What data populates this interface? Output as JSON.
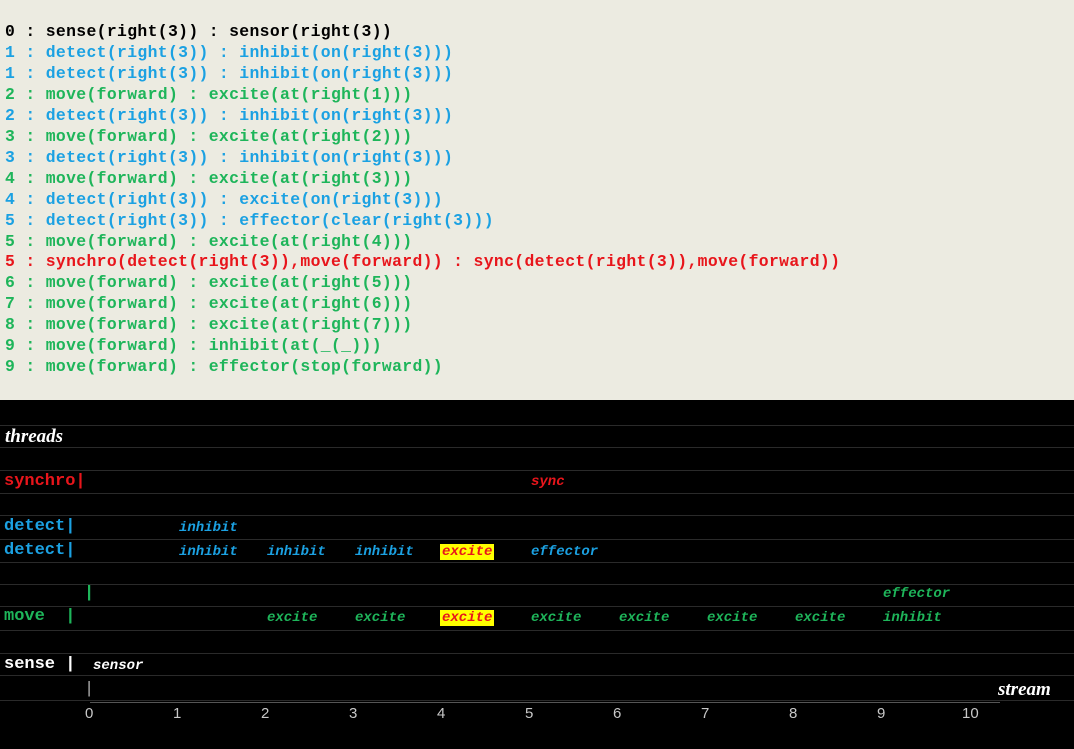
{
  "colors": {
    "black": "#000000",
    "blue": "#1ba1e2",
    "green": "#1eb55a",
    "red": "#e8151b",
    "white": "#ffffff",
    "highlight": "#ffff00"
  },
  "log": [
    {
      "text": "0 : sense(right(3)) : sensor(right(3))",
      "color": "black"
    },
    {
      "text": "1 : detect(right(3)) : inhibit(on(right(3)))",
      "color": "blue"
    },
    {
      "text": "1 : detect(right(3)) : inhibit(on(right(3)))",
      "color": "blue"
    },
    {
      "text": "2 : move(forward) : excite(at(right(1)))",
      "color": "green"
    },
    {
      "text": "2 : detect(right(3)) : inhibit(on(right(3)))",
      "color": "blue"
    },
    {
      "text": "3 : move(forward) : excite(at(right(2)))",
      "color": "green"
    },
    {
      "text": "3 : detect(right(3)) : inhibit(on(right(3)))",
      "color": "blue"
    },
    {
      "text": "4 : move(forward) : excite(at(right(3)))",
      "color": "green"
    },
    {
      "text": "4 : detect(right(3)) : excite(on(right(3)))",
      "color": "blue"
    },
    {
      "text": "5 : detect(right(3)) : effector(clear(right(3)))",
      "color": "blue"
    },
    {
      "text": "5 : move(forward) : excite(at(right(4)))",
      "color": "green"
    },
    {
      "text": "5 : synchro(detect(right(3)),move(forward)) : sync(detect(right(3)),move(forward))",
      "color": "red"
    },
    {
      "text": "6 : move(forward) : excite(at(right(5)))",
      "color": "green"
    },
    {
      "text": "7 : move(forward) : excite(at(right(6)))",
      "color": "green"
    },
    {
      "text": "8 : move(forward) : excite(at(right(7)))",
      "color": "green"
    },
    {
      "text": "9 : move(forward) : inhibit(at(_(_)))",
      "color": "green"
    },
    {
      "text": "9 : move(forward) : effector(stop(forward))",
      "color": "green"
    }
  ],
  "timeline": {
    "header": "threads",
    "stream_label": "stream",
    "axis_ticks": [
      "0",
      "1",
      "2",
      "3",
      "4",
      "5",
      "6",
      "7",
      "8",
      "9",
      "10"
    ],
    "rows": [
      {
        "name": "synchro-row",
        "label": "synchro|",
        "color": "red",
        "y": 0,
        "events": [
          {
            "t": 5,
            "text": "sync"
          }
        ]
      },
      {
        "name": "detect-row-1",
        "label": "detect|",
        "color": "blue",
        "y": 1,
        "events": [
          {
            "t": 1,
            "text": "inhibit"
          }
        ]
      },
      {
        "name": "detect-row-2",
        "label": "detect|",
        "color": "blue",
        "y": 2,
        "events": [
          {
            "t": 1,
            "text": "inhibit"
          },
          {
            "t": 2,
            "text": "inhibit"
          },
          {
            "t": 3,
            "text": "inhibit"
          },
          {
            "t": 4,
            "text": "excite",
            "highlight": true
          },
          {
            "t": 5,
            "text": "effector"
          }
        ]
      },
      {
        "name": "move-row-1",
        "label": "|",
        "color": "green",
        "y": 3,
        "events": [
          {
            "t": 9,
            "text": "effector"
          }
        ]
      },
      {
        "name": "move-row-2",
        "label": "move  |",
        "color": "green",
        "y": 4,
        "events": [
          {
            "t": 2,
            "text": "excite"
          },
          {
            "t": 3,
            "text": "excite"
          },
          {
            "t": 4,
            "text": "excite",
            "highlight": true
          },
          {
            "t": 5,
            "text": "excite"
          },
          {
            "t": 6,
            "text": "excite"
          },
          {
            "t": 7,
            "text": "excite"
          },
          {
            "t": 8,
            "text": "excite"
          },
          {
            "t": 9,
            "text": "inhibit"
          }
        ]
      },
      {
        "name": "sense-row",
        "label": "sense |",
        "color": "white",
        "y": 5,
        "events": [
          {
            "t": 0,
            "text": "sensor"
          }
        ]
      },
      {
        "name": "axis-row",
        "label": "|",
        "color": "white",
        "y": 6,
        "events": []
      }
    ]
  }
}
